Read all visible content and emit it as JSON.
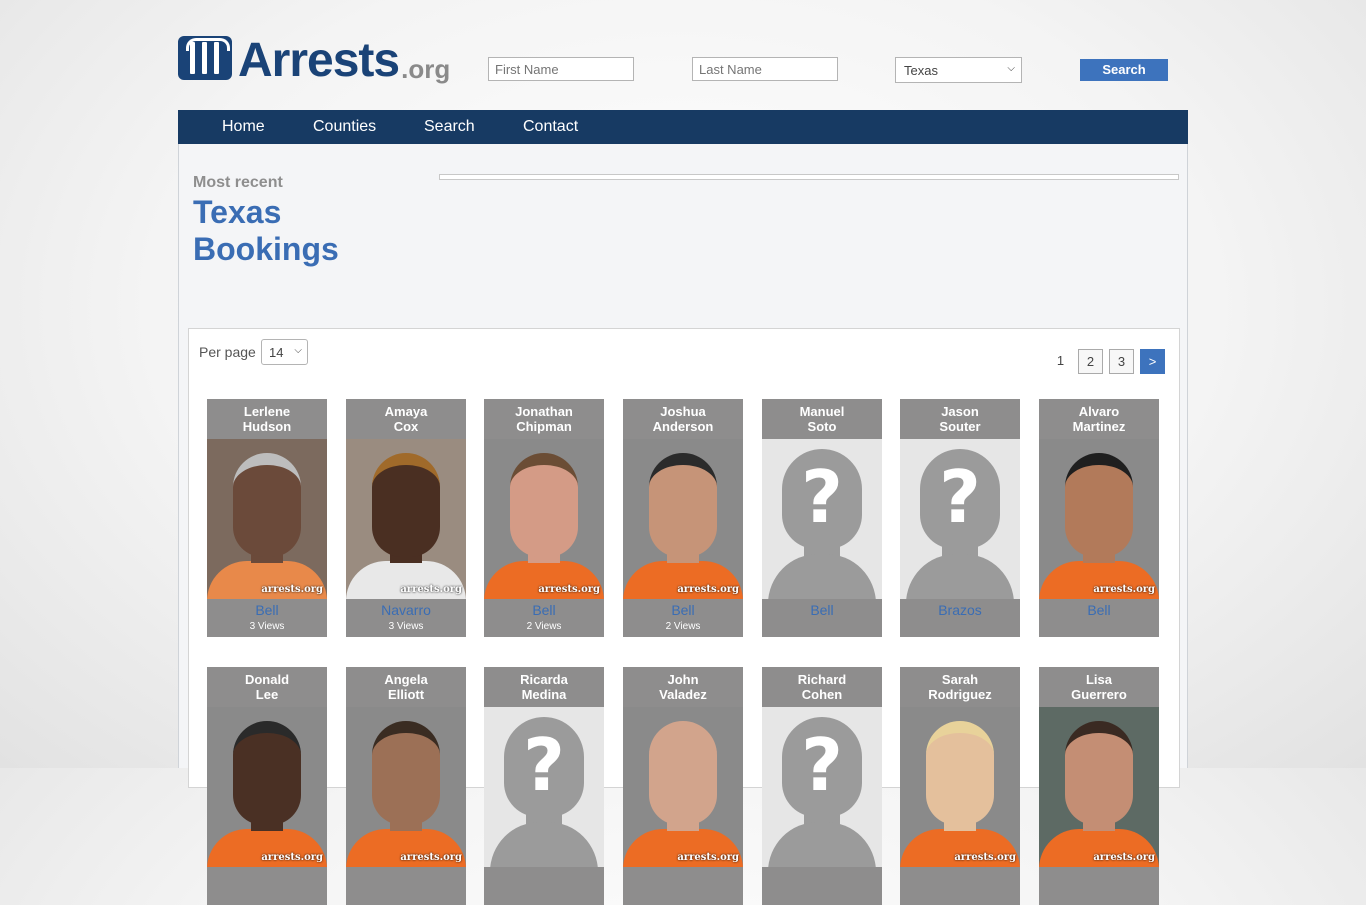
{
  "header": {
    "logo_main": "Arrests",
    "logo_suffix": ".org",
    "first_name_placeholder": "First Name",
    "last_name_placeholder": "Last Name",
    "state_selected": "Texas",
    "search_label": "Search"
  },
  "nav": {
    "items": [
      "Home",
      "Counties",
      "Search",
      "Contact"
    ]
  },
  "intro": {
    "eyebrow": "Most recent",
    "title": "Texas Bookings"
  },
  "listing": {
    "per_page_label": "Per page",
    "per_page_value": "14",
    "pages": [
      "1",
      "2",
      "3"
    ],
    "next_label": ">"
  },
  "bookings": [
    {
      "first": "Lerlene",
      "last": "Hudson",
      "county": "Bell",
      "views": "3 Views",
      "photo": "mugshot"
    },
    {
      "first": "Amaya",
      "last": "Cox",
      "county": "Navarro",
      "views": "3 Views",
      "photo": "mugshot"
    },
    {
      "first": "Jonathan",
      "last": "Chipman",
      "county": "Bell",
      "views": "2 Views",
      "photo": "mugshot"
    },
    {
      "first": "Joshua",
      "last": "Anderson",
      "county": "Bell",
      "views": "2 Views",
      "photo": "mugshot"
    },
    {
      "first": "Manuel",
      "last": "Soto",
      "county": "Bell",
      "views": "",
      "photo": "placeholder"
    },
    {
      "first": "Jason",
      "last": "Souter",
      "county": "Brazos",
      "views": "",
      "photo": "placeholder"
    },
    {
      "first": "Alvaro",
      "last": "Martinez",
      "county": "Bell",
      "views": "",
      "photo": "mugshot"
    },
    {
      "first": "Donald",
      "last": "Lee",
      "county": "",
      "views": "",
      "photo": "mugshot"
    },
    {
      "first": "Angela",
      "last": "Elliott",
      "county": "",
      "views": "",
      "photo": "mugshot"
    },
    {
      "first": "Ricarda",
      "last": "Medina",
      "county": "",
      "views": "",
      "photo": "placeholder"
    },
    {
      "first": "John",
      "last": "Valadez",
      "county": "",
      "views": "",
      "photo": "mugshot"
    },
    {
      "first": "Richard",
      "last": "Cohen",
      "county": "",
      "views": "",
      "photo": "placeholder"
    },
    {
      "first": "Sarah",
      "last": "Rodriguez",
      "county": "",
      "views": "",
      "photo": "mugshot"
    },
    {
      "first": "Lisa",
      "last": "Guerrero",
      "county": "",
      "views": "",
      "photo": "mugshot"
    }
  ],
  "watermark": "arrests.org",
  "placeholder_mark": "?",
  "colors": {
    "brand": "#1a4377",
    "nav": "#173a63",
    "accent": "#3d73bd",
    "link": "#3a6db4",
    "card": "#8e8d8d"
  }
}
